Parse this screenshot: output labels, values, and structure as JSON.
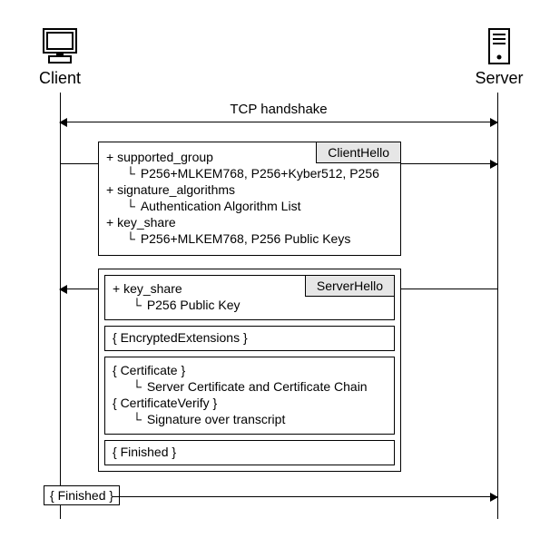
{
  "endpoints": {
    "client_label": "Client",
    "server_label": "Server"
  },
  "tcp_label": "TCP handshake",
  "client_hello": {
    "badge": "ClientHello",
    "supported_group": "+ supported_group",
    "supported_group_val": "P256+MLKEM768, P256+Kyber512, P256",
    "signature_algorithms": "+ signature_algorithms",
    "signature_algorithms_val": "Authentication Algorithm List",
    "key_share": "+ key_share",
    "key_share_val": "P256+MLKEM768, P256 Public Keys"
  },
  "server_group": {
    "server_hello": {
      "badge": "ServerHello",
      "key_share": "+ key_share",
      "key_share_val": "P256 Public Key"
    },
    "encrypted_extensions": "{ EncryptedExtensions }",
    "cert_box": {
      "certificate": "{ Certificate }",
      "certificate_val": "Server Certificate and Certificate Chain",
      "certificate_verify": "{ CertificateVerify }",
      "certificate_verify_val": "Signature over transcript"
    },
    "finished": "{ Finished }"
  },
  "client_finished": "{ Finished }"
}
